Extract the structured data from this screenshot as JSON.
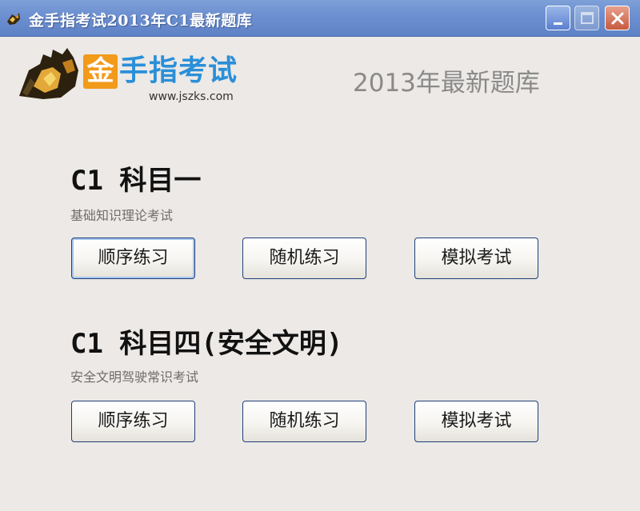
{
  "window": {
    "title": "金手指考试2013年C1最新题库",
    "icon": "app-logo-icon",
    "title_color": "#6b8fd0"
  },
  "header": {
    "logo_char": "金",
    "logo_name": "手指考试",
    "logo_url": "www.jszks.com",
    "banner_title": "2013年最新题库",
    "brand_orange": "#f29a1a",
    "brand_blue": "#2a8fd8"
  },
  "sections": [
    {
      "title": "C1 科目一",
      "subtitle": "基础知识理论考试",
      "buttons": [
        "顺序练习",
        "随机练习",
        "模拟考试"
      ]
    },
    {
      "title": "C1 科目四(安全文明)",
      "subtitle": "安全文明驾驶常识考试",
      "buttons": [
        "顺序练习",
        "随机练习",
        "模拟考试"
      ]
    }
  ]
}
